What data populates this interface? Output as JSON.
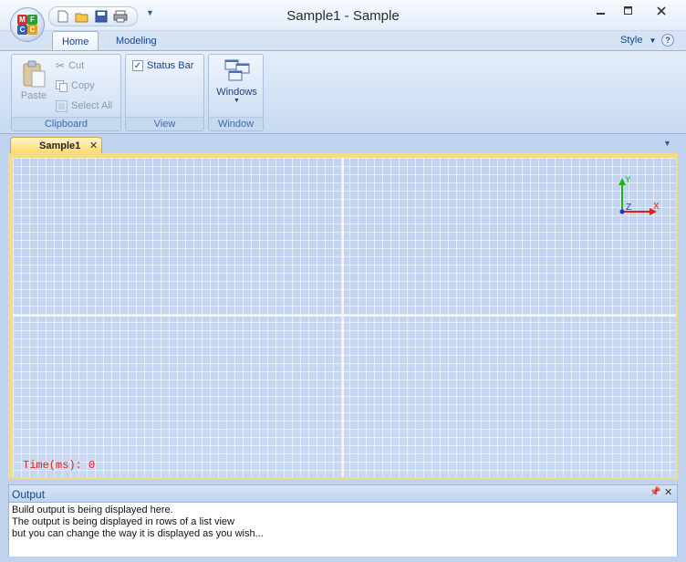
{
  "window": {
    "title": "Sample1 - Sample",
    "app_button_letters": [
      "M",
      "F",
      "C",
      "C"
    ]
  },
  "quick_access": [
    "new-icon",
    "open-icon",
    "save-icon",
    "print-icon"
  ],
  "ribbon": {
    "tabs": [
      {
        "label": "Home",
        "active": true
      },
      {
        "label": "Modeling",
        "active": false
      }
    ],
    "style_label": "Style",
    "help_glyph": "?",
    "groups": {
      "clipboard": {
        "label": "Clipboard",
        "paste": "Paste",
        "cut": "Cut",
        "copy": "Copy",
        "select_all": "Select All"
      },
      "view": {
        "label": "View",
        "status_bar": "Status Bar",
        "status_bar_checked": true
      },
      "window": {
        "label": "Window",
        "windows": "Windows"
      }
    }
  },
  "document": {
    "tab_label": "Sample1"
  },
  "viewport": {
    "time_label": "Time(ms): 0",
    "axes": {
      "x": "X",
      "y": "Y",
      "z": "Z"
    },
    "colors": {
      "x": "#e02020",
      "y": "#20b020",
      "z": "#2030d0"
    }
  },
  "output": {
    "title": "Output",
    "lines": [
      "Build output is being displayed here.",
      "The output is being displayed in rows of a list view",
      "but you can change the way it is displayed as you wish..."
    ]
  }
}
